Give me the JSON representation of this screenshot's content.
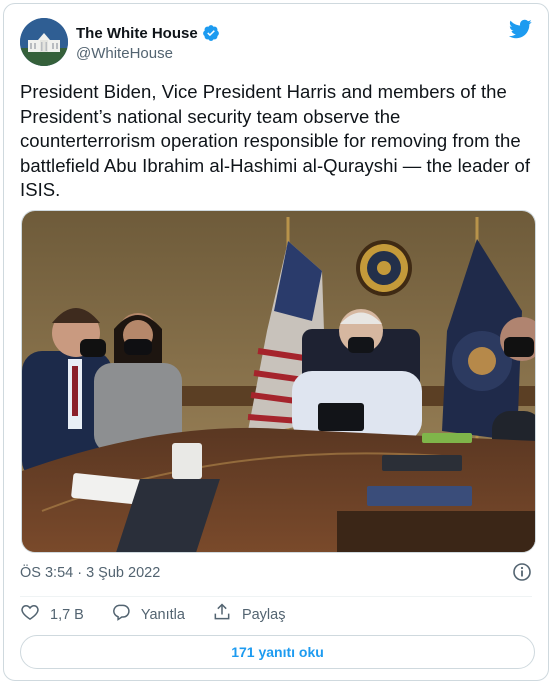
{
  "tweet": {
    "author": {
      "display_name": "The White House",
      "handle": "@WhiteHouse",
      "verified": true,
      "avatar_icon": "white-house-building-avatar"
    },
    "text": "President Biden, Vice President Harris and members of the President’s national security team observe the counterterrorism operation responsible for removing from the battlefield Abu Ibrahim al-Hashimi al-Qurayshi — the leader of ISIS.",
    "media": {
      "type": "photo"
    },
    "timestamp": "ÖS 3:54 · 3 Şub 2022",
    "actions": {
      "like_count": "1,7 B",
      "reply_label": "Yanıtla",
      "share_label": "Paylaş"
    },
    "read_replies_label": "171 yanıtı oku"
  },
  "colors": {
    "accent": "#1d9bf0",
    "text_primary": "#0f1419",
    "text_secondary": "#536471",
    "border": "#cfd9de"
  },
  "icons": [
    "twitter-bird-icon",
    "verified-badge-icon",
    "info-icon",
    "heart-icon",
    "reply-bubble-icon",
    "share-icon"
  ]
}
